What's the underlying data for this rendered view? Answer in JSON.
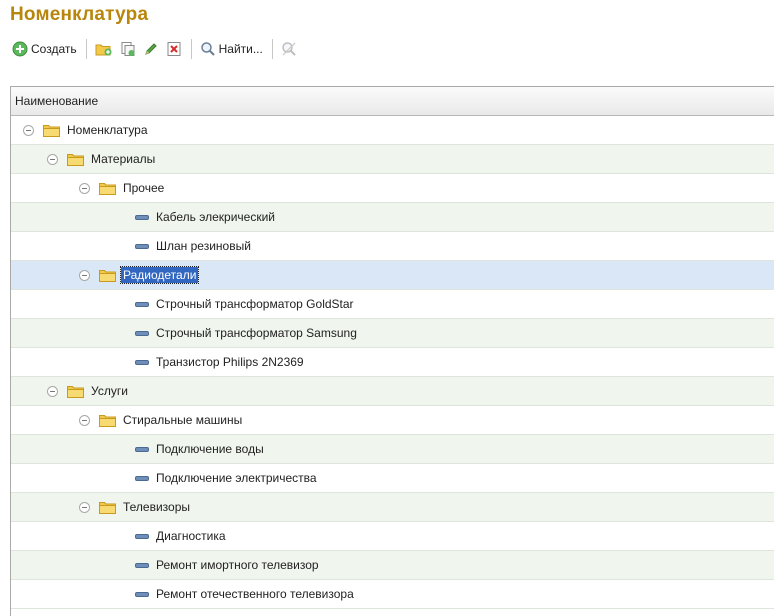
{
  "page": {
    "title": "Номенклатура"
  },
  "toolbar": {
    "create_label": "Создать",
    "find_label": "Найти..."
  },
  "grid": {
    "column_header": "Наименование",
    "rows": [
      {
        "label": "Номенклатура",
        "type": "folder",
        "level": 0,
        "expanded": true
      },
      {
        "label": "Материалы",
        "type": "folder",
        "level": 1,
        "expanded": true
      },
      {
        "label": "Прочее",
        "type": "folder",
        "level": 2,
        "expanded": true
      },
      {
        "label": "Кабель элекрический",
        "type": "item",
        "level": 3
      },
      {
        "label": "Шлан резиновый",
        "type": "item",
        "level": 3
      },
      {
        "label": "Радиодетали",
        "type": "folder",
        "level": 2,
        "expanded": true,
        "selected": true
      },
      {
        "label": "Строчный трансформатор GoldStar",
        "type": "item",
        "level": 3
      },
      {
        "label": "Строчный трансформатор Samsung",
        "type": "item",
        "level": 3
      },
      {
        "label": "Транзистор Philips 2N2369",
        "type": "item",
        "level": 3
      },
      {
        "label": "Услуги",
        "type": "folder",
        "level": 1,
        "expanded": true
      },
      {
        "label": "Стиральные машины",
        "type": "folder",
        "level": 2,
        "expanded": true
      },
      {
        "label": "Подключение воды",
        "type": "item",
        "level": 3
      },
      {
        "label": "Подключение электричества",
        "type": "item",
        "level": 3
      },
      {
        "label": "Телевизоры",
        "type": "folder",
        "level": 2,
        "expanded": true
      },
      {
        "label": "Диагностика",
        "type": "item",
        "level": 3
      },
      {
        "label": "Ремонт имортного телевизор",
        "type": "item",
        "level": 3
      },
      {
        "label": "Ремонт отечественного телевизора",
        "type": "item",
        "level": 3
      }
    ]
  },
  "colors": {
    "title": "#b8860b",
    "row_alt": "#f0f5ee",
    "row_selected": "#d9e7f7",
    "selection": "#3166c1",
    "folder": "#f3c94a",
    "item_dash": "#6f8fb8"
  },
  "icons": [
    "create-plus-icon",
    "new-folder-icon",
    "copy-icon",
    "edit-pencil-icon",
    "delete-icon",
    "find-icon",
    "cancel-search-icon",
    "collapse-icon",
    "folder-icon",
    "item-icon"
  ]
}
